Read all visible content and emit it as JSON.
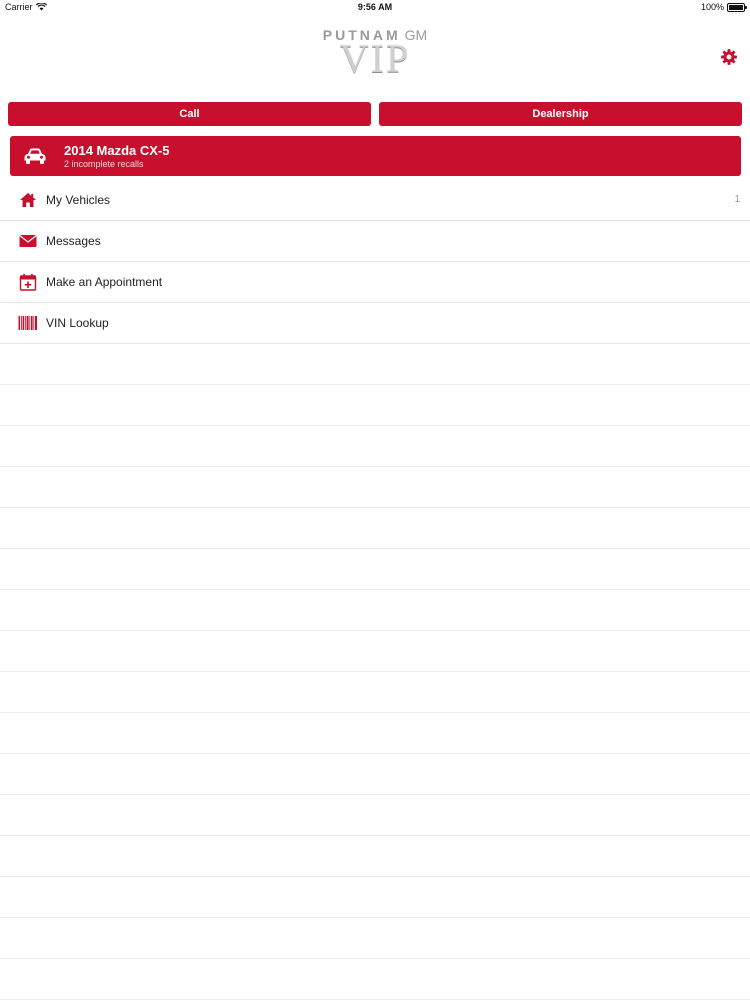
{
  "status_bar": {
    "carrier": "Carrier",
    "time": "9:56 AM",
    "battery": "100%",
    "battery_level": 1.0
  },
  "logo": {
    "brand": "PUTNAM",
    "brand_suffix": "GM",
    "title": "VIP"
  },
  "actions": {
    "call_label": "Call",
    "dealership_label": "Dealership"
  },
  "vehicle": {
    "name": "2014 Mazda CX-5",
    "recalls": "2 incomplete recalls",
    "icon": "car-icon"
  },
  "menu": {
    "items": [
      {
        "label": "My Vehicles",
        "icon": "home-icon",
        "count": "1"
      },
      {
        "label": "Messages",
        "icon": "envelope-icon"
      },
      {
        "label": "Make an Appointment",
        "icon": "calendar-plus-icon"
      },
      {
        "label": "VIN Lookup",
        "icon": "barcode-icon"
      }
    ]
  },
  "colors": {
    "accent": "#c8102e",
    "divider": "#e4e4e4",
    "background": "#ffffff"
  }
}
